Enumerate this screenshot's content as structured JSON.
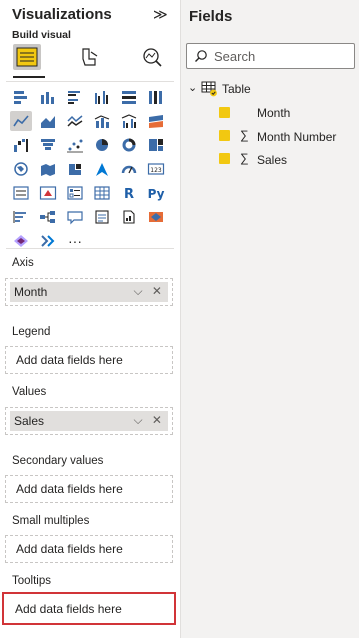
{
  "visualizations": {
    "title": "Visualizations",
    "build_label": "Build visual",
    "wells": [
      {
        "label": "Axis",
        "chip": "Month",
        "placeholder": ""
      },
      {
        "label": "Legend",
        "chip": "",
        "placeholder": "Add data fields here"
      },
      {
        "label": "Values",
        "chip": "Sales",
        "placeholder": ""
      },
      {
        "label": "Secondary values",
        "chip": "",
        "placeholder": "Add data fields here"
      },
      {
        "label": "Small multiples",
        "chip": "",
        "placeholder": "Add data fields here"
      },
      {
        "label": "Tooltips",
        "chip": "",
        "placeholder": "Add data fields here"
      }
    ],
    "more_glyph": "···",
    "chip_controls": "⌵ ✕"
  },
  "fields": {
    "title": "Fields",
    "search_placeholder": "Search",
    "table_name": "Table",
    "items": [
      {
        "name": "Month",
        "sigma": ""
      },
      {
        "name": "Month Number",
        "sigma": "∑"
      },
      {
        "name": "Sales",
        "sigma": "∑"
      }
    ]
  },
  "colors": {
    "accent_yellow": "#f2c811",
    "highlight_red": "#d13438",
    "icon_blue": "#3c6ca8"
  },
  "icons": [
    "collapse-icon",
    "build-visual-icon",
    "format-visual-icon",
    "analytics-icon",
    "search-icon",
    "table-icon",
    "check-icon",
    "sigma-icon"
  ]
}
